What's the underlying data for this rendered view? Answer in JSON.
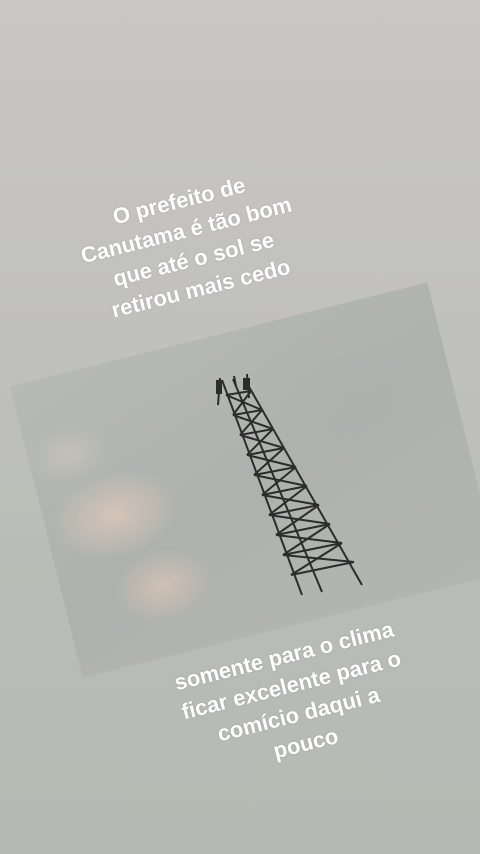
{
  "caption_top": {
    "lines": [
      "O prefeito de",
      "Canutama é tão bom",
      "que até o sol se",
      "retirou mais cedo"
    ]
  },
  "caption_bottom": {
    "lines": [
      "somente para o clima",
      "ficar excelente para o",
      "comício daqui a",
      "pouco"
    ]
  },
  "photo": {
    "subject": "telecommunication-tower"
  }
}
